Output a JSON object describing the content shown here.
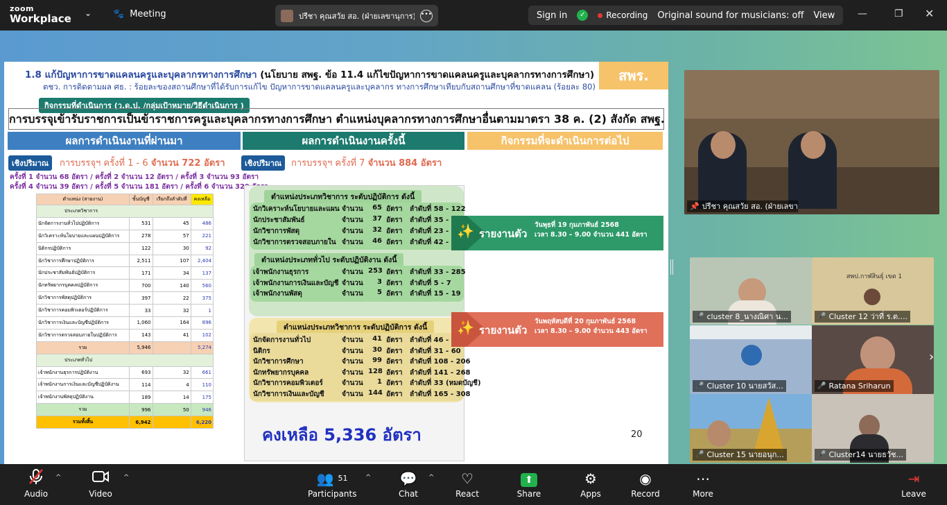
{
  "app": {
    "brand_line1": "zoom",
    "brand_line2": "Workplace",
    "meeting_label": "Meeting"
  },
  "share_banner": {
    "name": "ปรีชา  คุณสวัย สอ. (ฝ่ายเลขานุการ)'s s"
  },
  "status": {
    "sign_in": "Sign in",
    "recording": "Recording",
    "original_sound": "Original sound for musicians: off",
    "view": "View"
  },
  "slide": {
    "title": "1.8 แก้ปัญหาการขาดแคลนครูและบุคลากรทางการศึกษา",
    "title_policy": "(นโยบาย สพฐ. ข้อ 11.4 แก้ไขปัญหาการขาดแคลนครูและบุคลากรทางการศึกษา)",
    "subtitle": "ตชว. การติดตามผล ศธ. : ร้อยละของสถานศึกษาที่ได้รับการแก้ไข ปัญหาการขาดแคลนครูและบุคลากร ทางการศึกษาเทียบกับสถานศึกษาที่ขาดแคลน (ร้อยละ 80)",
    "badge": "สพร.",
    "activity_tag": "กิจกรรมที่ดำเนินการ (ว.ด.ป. /กลุ่มเป้าหมาย/วิธีดำเนินการ )",
    "heading": "การบรรจุเข้ารับราชการเป็นข้าราชการครูและบุคลากรทางการศึกษา ตำแหน่งบุคลากรทางการศึกษาอื่นตามมาตรา 38 ค. (2) สังกัด สพฐ.",
    "col_past": "ผลการดำเนินงานที่ผ่านมา",
    "col_now": "ผลการดำเนินงานครั้งนี้",
    "col_next": "กิจกรรมที่จะดำเนินการต่อไป",
    "qty_tag": "เชิงปริมาณ",
    "past_summary_a": "การบรรจุฯ ครั้งที่ 1 - 6 ",
    "past_summary_b": "จำนวน 722 อัตรา",
    "rounds_line1": "ครั้งที่ 1 จำนวน 68 อัตรา / ครั้งที่ 2 จำนวน 12 อัตรา / ครั้งที่ 3 จำนวน 93 อัตรา",
    "rounds_line2": "ครั้งที่ 4 จำนวน 39 อัตรา / ครั้งที่ 5 จำนวน 181 อัตรา / ครั้งที่ 6 จำนวน 329 อัตรา",
    "table": {
      "headers": [
        "ตำแหน่ง (สายงาน)",
        "ขั้นบัญชี",
        "เรียกถึงลำดับที่",
        "คงเหลือ"
      ],
      "section1": "ประเภทวิชาการ",
      "rows1": [
        [
          "นักจัดการงานทั่วไปปฏิบัติการ",
          "531",
          "45",
          "486"
        ],
        [
          "นักวิเคราะห์นโยบายและแผนปฏิบัติการ",
          "278",
          "57",
          "221"
        ],
        [
          "นิติกรปฏิบัติการ",
          "122",
          "30",
          "92"
        ],
        [
          "นักวิชาการศึกษาปฏิบัติการ",
          "2,511",
          "107",
          "2,404"
        ],
        [
          "นักประชาสัมพันธ์ปฏิบัติการ",
          "171",
          "34",
          "137"
        ],
        [
          "นักทรัพยากรบุคคลปฏิบัติการ",
          "700",
          "140",
          "560"
        ],
        [
          "นักวิชาการพัสดุปฏิบัติการ",
          "397",
          "22",
          "375"
        ],
        [
          "นักวิชาการคอมพิวเตอร์ปฏิบัติการ",
          "33",
          "32",
          "1"
        ],
        [
          "นักวิชาการเงินและบัญชีปฏิบัติการ",
          "1,060",
          "164",
          "896"
        ],
        [
          "นักวิชาการตรวจสอบภายในปฏิบัติการ",
          "143",
          "41",
          "102"
        ]
      ],
      "sum1": [
        "รวม",
        "5,946",
        "",
        "5,274"
      ],
      "section2": "ประเภททั่วไป",
      "rows2": [
        [
          "เจ้าพนักงานธุรการปฏิบัติงาน",
          "693",
          "32",
          "661"
        ],
        [
          "เจ้าพนักงานการเงินและบัญชีปฏิบัติงาน",
          "114",
          "4",
          "110"
        ],
        [
          "เจ้าพนักงานพัสดุปฏิบัติงาน",
          "189",
          "14",
          "175"
        ]
      ],
      "sum2": [
        "รวม",
        "996",
        "50",
        "946"
      ],
      "total": [
        "รวมทั้งสิ้น",
        "6,942",
        "",
        "6,220"
      ]
    },
    "now_summary_a": "การบรรจุฯ ครั้งที่ 7 ",
    "now_summary_b": "จำนวน 884 อัตรา",
    "grp1": "ตำแหน่งประเภทวิชาการ ระดับปฏิบัติการ ดังนี้",
    "grp1_rows": [
      [
        "นักวิเคราะห์นโยบายและแผน",
        "จำนวน",
        "65",
        "อัตรา",
        "ลำดับที่ 58 - 122"
      ],
      [
        "นักประชาสัมพันธ์",
        "จำนวน",
        "37",
        "อัตรา",
        "ลำดับที่ 35 - 71"
      ],
      [
        "นักวิชาการพัสดุ",
        "จำนวน",
        "32",
        "อัตรา",
        "ลำดับที่ 23 - 54"
      ],
      [
        "นักวิชาการตรวจสอบภายใน",
        "จำนวน",
        "46",
        "อัตรา",
        "ลำดับที่ 42 - 87"
      ]
    ],
    "grp2": "ตำแหน่งประเภททั่วไป ระดับปฏิบัติงาน ดังนี้",
    "grp2_rows": [
      [
        "เจ้าพนักงานธุรการ",
        "จำนวน",
        "253",
        "อัตรา",
        "ลำดับที่ 33 - 285"
      ],
      [
        "เจ้าพนักงานการเงินและบัญชี",
        "จำนวน",
        "3",
        "อัตรา",
        "ลำดับที่ 5 - 7"
      ],
      [
        "เจ้าพนักงานพัสดุ",
        "จำนวน",
        "5",
        "อัตรา",
        "ลำดับที่ 15 - 19"
      ]
    ],
    "grp3": "ตำแหน่งประเภทวิชาการ ระดับปฏิบัติการ ดังนี้",
    "grp3_rows": [
      [
        "นักจัดการงานทั่วไป",
        "จำนวน",
        "41",
        "อัตรา",
        "ลำดับที่ 46 - 88"
      ],
      [
        "นิติกร",
        "จำนวน",
        "30",
        "อัตรา",
        "ลำดับที่ 31 - 60"
      ],
      [
        "นักวิชาการศึกษา",
        "จำนวน",
        "99",
        "อัตรา",
        "ลำดับที่ 108 - 206"
      ],
      [
        "นักทรัพยากรบุคคล",
        "จำนวน",
        "128",
        "อัตรา",
        "ลำดับที่ 141 - 268"
      ],
      [
        "นักวิชาการคอมพิวเตอร์",
        "จำนวน",
        "1",
        "อัตรา",
        "ลำดับที่ 33 (หมดบัญชี)"
      ],
      [
        "นักวิชาการเงินและบัญชี",
        "จำนวน",
        "144",
        "อัตรา",
        "ลำดับที่ 165 - 308"
      ]
    ],
    "remaining": "คงเหลือ 5,336 อัตรา",
    "page_number": "20",
    "report1_label": "รายงานตัว",
    "report1_l1": "วันพุธที่ 19 กุมภาพันธ์ 2568",
    "report1_l2": "เวลา 8.30 – 9.00 จำนวน 441 อัตรา",
    "report2_label": "รายงานตัว",
    "report2_l1": "วันพฤหัสบดีที่ 20 กุมภาพันธ์ 2568",
    "report2_l2": "เวลา 8.30 – 9.00 จำนวน 443 อัตรา"
  },
  "speaker": {
    "name": "ปรีชา  คุณสวัย สอ. (ฝ่ายเลขานุการ)"
  },
  "participants": [
    {
      "name": "cluster 8_นางณิศา น..."
    },
    {
      "name": "Cluster 12 ว่าที่ ร.ต...."
    },
    {
      "name": "Cluster 10 นายสวัส..."
    },
    {
      "name": "Ratana Sriharun"
    },
    {
      "name": "Cluster 15 นายอนุก..."
    },
    {
      "name": "Cluster14 นายธวัช..."
    }
  ],
  "room_sign": "สพป.กาฬสินธุ์ เขต 1",
  "toolbar": {
    "audio": "Audio",
    "video": "Video",
    "participants": "Participants",
    "participants_count": "51",
    "chat": "Chat",
    "react": "React",
    "share": "Share",
    "apps": "Apps",
    "record": "Record",
    "more": "More",
    "leave": "Leave"
  },
  "colors": {
    "accent_green": "#22b14c",
    "recording_red": "#e53935",
    "teal": "#1c7a6e",
    "blue": "#3e7fc1",
    "orange": "#f6c26a"
  }
}
